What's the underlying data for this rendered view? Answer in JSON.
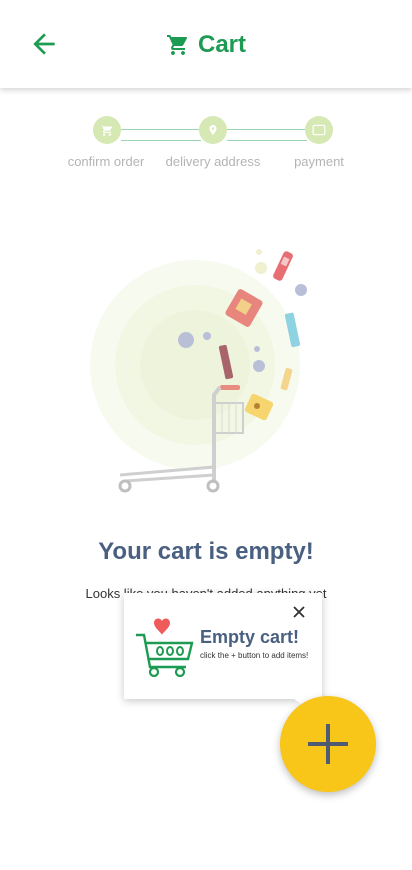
{
  "header": {
    "title": "Cart",
    "back_icon": "arrow-left-icon",
    "cart_icon": "shopping-cart-icon"
  },
  "stepper": {
    "steps": [
      {
        "label": "confirm order",
        "icon": "cart-icon"
      },
      {
        "label": "delivery address",
        "icon": "location-pin-icon"
      },
      {
        "label": "payment",
        "icon": "card-icon"
      }
    ]
  },
  "empty_state": {
    "title": "Your cart is empty!",
    "subtitle": "Looks like you haven't added anything yet"
  },
  "tooltip": {
    "title": "Empty cart!",
    "subtitle": "click the + button to add items!",
    "close_icon": "close-icon"
  },
  "fab": {
    "icon": "plus-icon"
  },
  "colors": {
    "primary_green": "#1e9b52",
    "title_blue": "#4a6081",
    "fab_yellow": "#f8c519",
    "step_dot": "#d6e8b4"
  }
}
